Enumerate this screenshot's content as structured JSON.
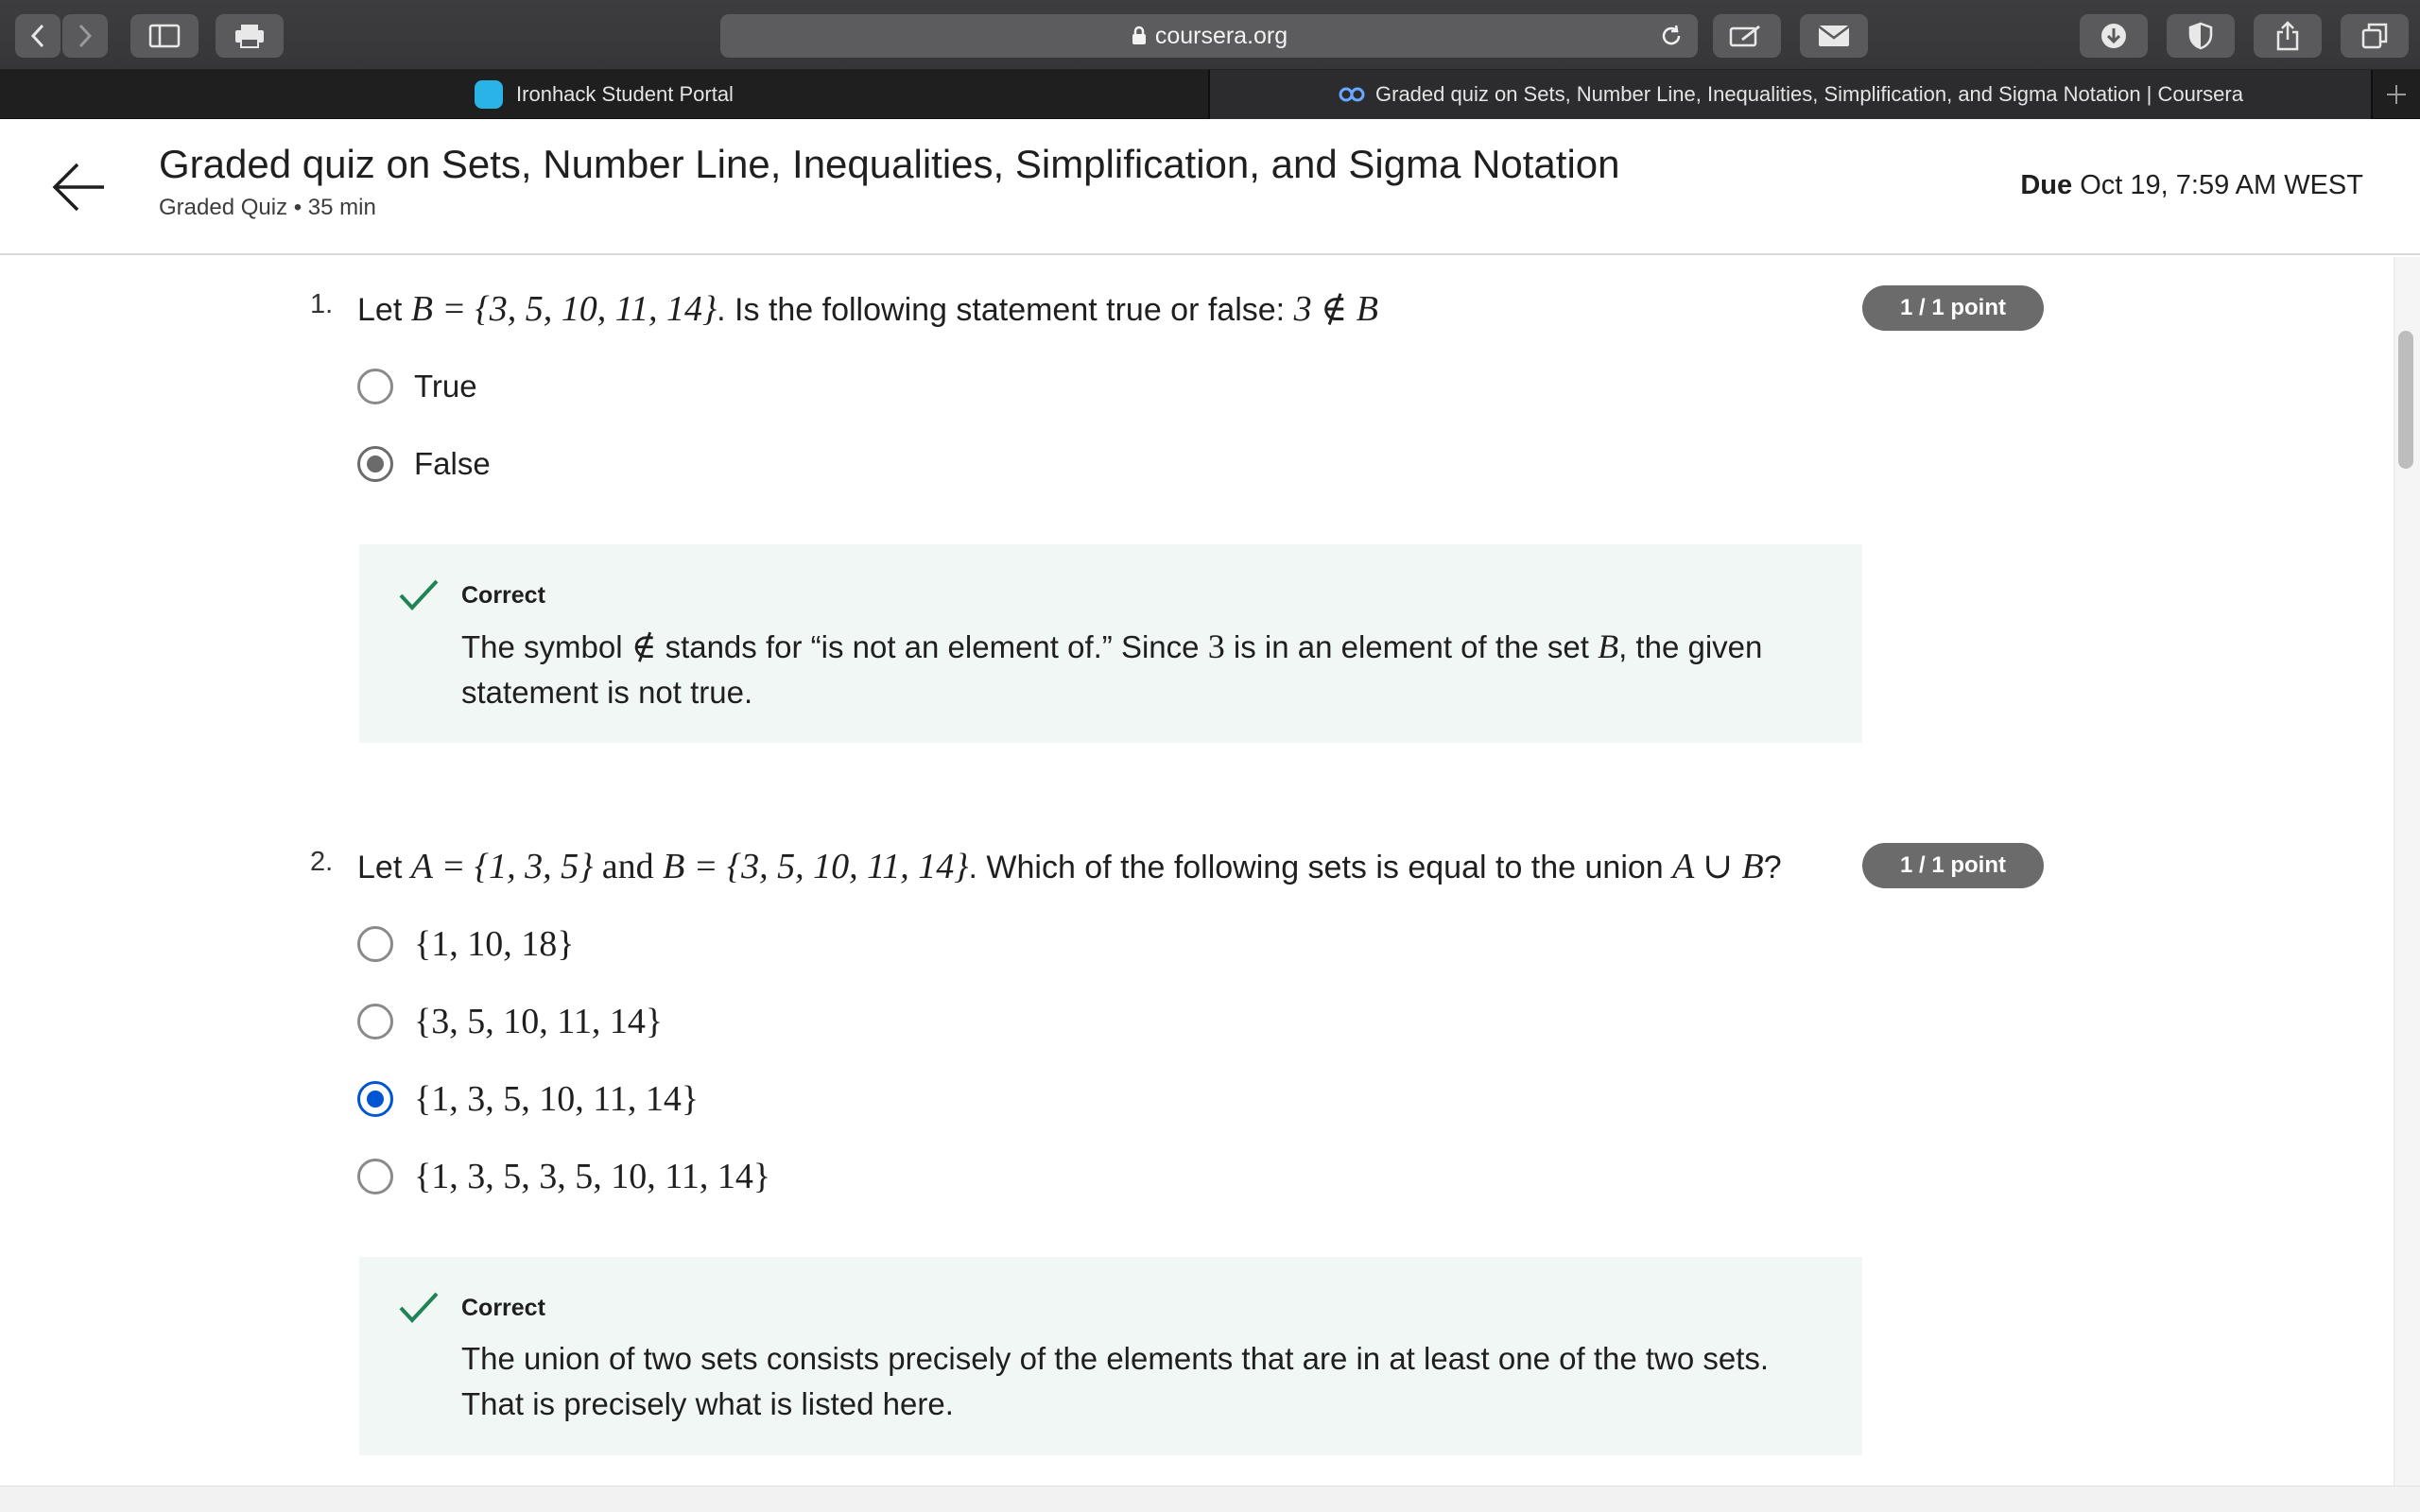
{
  "browser": {
    "url": "coursera.org",
    "tabs": [
      {
        "title": "Ironhack Student Portal",
        "icon": "ironhack-hex-icon",
        "active": false
      },
      {
        "title": "Graded quiz on Sets, Number Line, Inequalities, Simplification, and Sigma Notation | Coursera",
        "icon": "coursera-logo-icon",
        "active": true
      }
    ]
  },
  "header": {
    "title": "Graded quiz on Sets, Number Line, Inequalities, Simplification, and Sigma Notation",
    "subtitle": "Graded Quiz • 35 min",
    "due_label": "Due",
    "due_value": "Oct 19, 7:59 AM WEST"
  },
  "questions": [
    {
      "number": "1.",
      "text_prefix": "Let",
      "math_set": "B = {3, 5, 10, 11, 14}",
      "text_middle": ". Is the following statement true or false:",
      "math_statement": "3 ∉ B",
      "points": "1 / 1 point",
      "options": [
        {
          "label": "True",
          "selected": false
        },
        {
          "label": "False",
          "selected": true
        }
      ],
      "feedback": {
        "title": "Correct",
        "text_1": "The symbol",
        "symbol": "∉",
        "text_2": "stands for “is not an element of.” Since",
        "num": "3",
        "text_3": "is in an element of the set",
        "set": "B",
        "text_4": ", the given",
        "text_5": "statement is not true."
      }
    },
    {
      "number": "2.",
      "text_prefix": "Let",
      "math_a": "A = {1, 3, 5}",
      "math_and": "and",
      "math_b": "B = {3, 5, 10, 11, 14}",
      "text_middle": ". Which of the following sets is equal to the union",
      "math_union": "A ∪ B",
      "text_end": "?",
      "points": "1 / 1 point",
      "options": [
        {
          "label": "{1, 10, 18}",
          "selected": false
        },
        {
          "label": "{3, 5, 10, 11, 14}",
          "selected": false
        },
        {
          "label": "{1, 3, 5, 10, 11, 14}",
          "selected": true
        },
        {
          "label": "{1, 3, 5, 3, 5, 10, 11, 14}",
          "selected": false
        }
      ],
      "feedback": {
        "title": "Correct",
        "text_line1": "The union of two sets consists precisely of the elements that are in at least one of the two sets.",
        "text_line2": "That is precisely what is listed here."
      }
    }
  ],
  "colors": {
    "selected_blue": "#0056d2",
    "badge_gray": "#6b6b6b",
    "feedback_bg": "#f1f7f5",
    "check_green": "#1f8354"
  }
}
